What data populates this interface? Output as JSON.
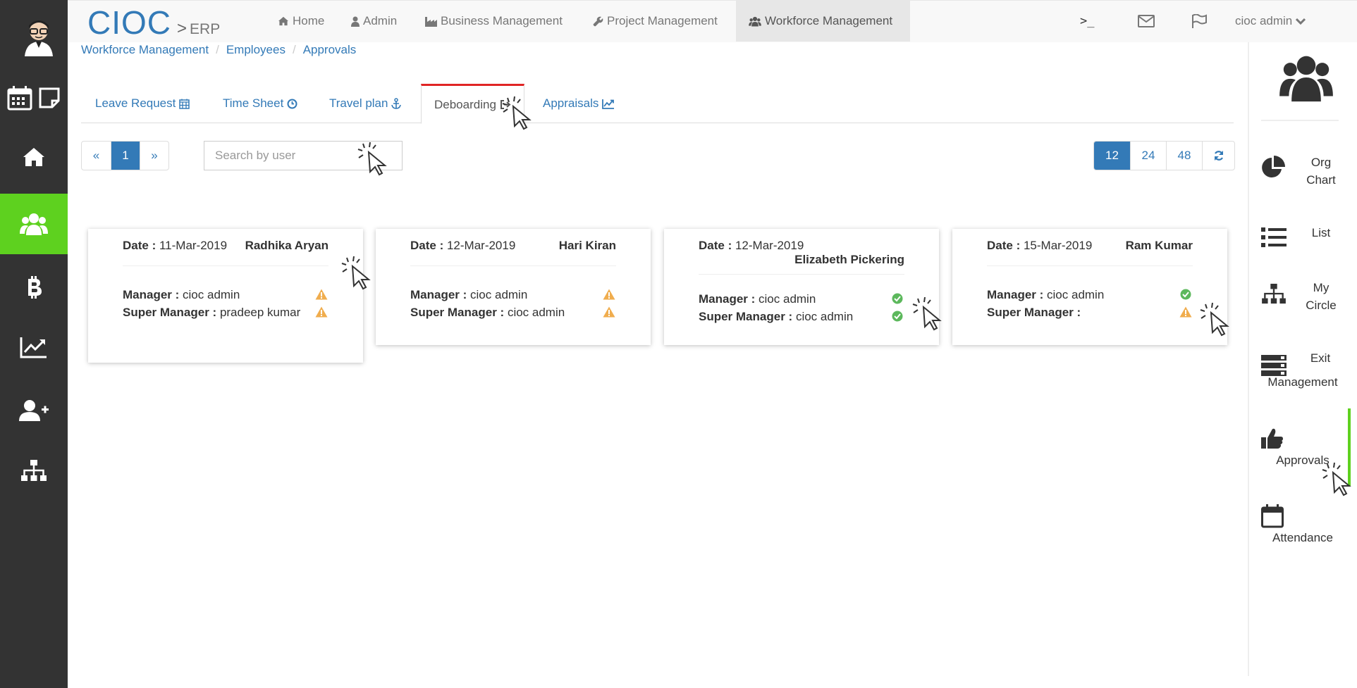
{
  "brand": {
    "name": "CIOC",
    "separator": ">",
    "sub": "ERP"
  },
  "nav": {
    "items": [
      {
        "label": "Home",
        "icon": "home-icon"
      },
      {
        "label": "Admin",
        "icon": "user-icon"
      },
      {
        "label": "Business Management",
        "icon": "industry-icon"
      },
      {
        "label": "Project Management",
        "icon": "wrench-icon"
      },
      {
        "label": "Workforce Management",
        "icon": "users-icon"
      }
    ],
    "terminal_label": ">_",
    "user_label": "cioc admin"
  },
  "breadcrumb": [
    "Workforce Management",
    "Employees",
    "Approvals"
  ],
  "breadcrumb_sep": "/",
  "tabs": [
    {
      "label": "Leave Request",
      "icon": "calendar-icon"
    },
    {
      "label": "Time Sheet",
      "icon": "clock-icon"
    },
    {
      "label": "Travel plan",
      "icon": "anchor-icon"
    },
    {
      "label": "Deboarding",
      "icon": "sign-out-icon",
      "active": true
    },
    {
      "label": "Appraisals",
      "icon": "line-chart-icon"
    }
  ],
  "pagination": {
    "prev": "«",
    "current": "1",
    "next": "»"
  },
  "search": {
    "placeholder": "Search by user",
    "value": ""
  },
  "page_size": {
    "options": [
      "12",
      "24",
      "48"
    ],
    "selected": "12",
    "refresh_icon": "refresh-icon"
  },
  "labels": {
    "date": "Date :",
    "manager": "Manager :",
    "super_manager": "Super Manager :"
  },
  "cards": [
    {
      "date": "11-Mar-2019",
      "name": "Radhika Aryan",
      "manager": "cioc admin",
      "manager_status": "warning",
      "super_manager": "pradeep kumar",
      "super_manager_status": "warning"
    },
    {
      "date": "12-Mar-2019",
      "name": "Hari Kiran",
      "manager": "cioc admin",
      "manager_status": "warning",
      "super_manager": "cioc admin",
      "super_manager_status": "warning"
    },
    {
      "date": "12-Mar-2019",
      "name": "Elizabeth Pickering",
      "manager": "cioc admin",
      "manager_status": "approved",
      "super_manager": "cioc admin",
      "super_manager_status": "approved"
    },
    {
      "date": "15-Mar-2019",
      "name": "Ram Kumar",
      "manager": "cioc admin",
      "manager_status": "approved",
      "super_manager": "",
      "super_manager_status": "warning"
    }
  ],
  "right_sidebar": [
    {
      "label_line1": "Org",
      "label_line2": "Chart",
      "icon": "pie-chart-icon"
    },
    {
      "label_line1": "List",
      "label_line2": "",
      "icon": "list-icon"
    },
    {
      "label_line1": "My",
      "label_line2": "Circle",
      "icon": "sitemap-icon"
    },
    {
      "label_line1": "Exit",
      "label_line2": "Management",
      "icon": "server-icon"
    },
    {
      "label_line1": "Approvals",
      "label_line2": "",
      "icon": "thumbs-up-icon"
    },
    {
      "label_line1": "Attendance",
      "label_line2": "",
      "icon": "calendar-icon"
    }
  ],
  "colors": {
    "accent": "#337ab7",
    "active_green": "#5ed11f",
    "sidebar_bg": "#333333",
    "warning": "#f0ad4e",
    "success": "#5cb85c",
    "active_tab_border": "#e02424"
  }
}
